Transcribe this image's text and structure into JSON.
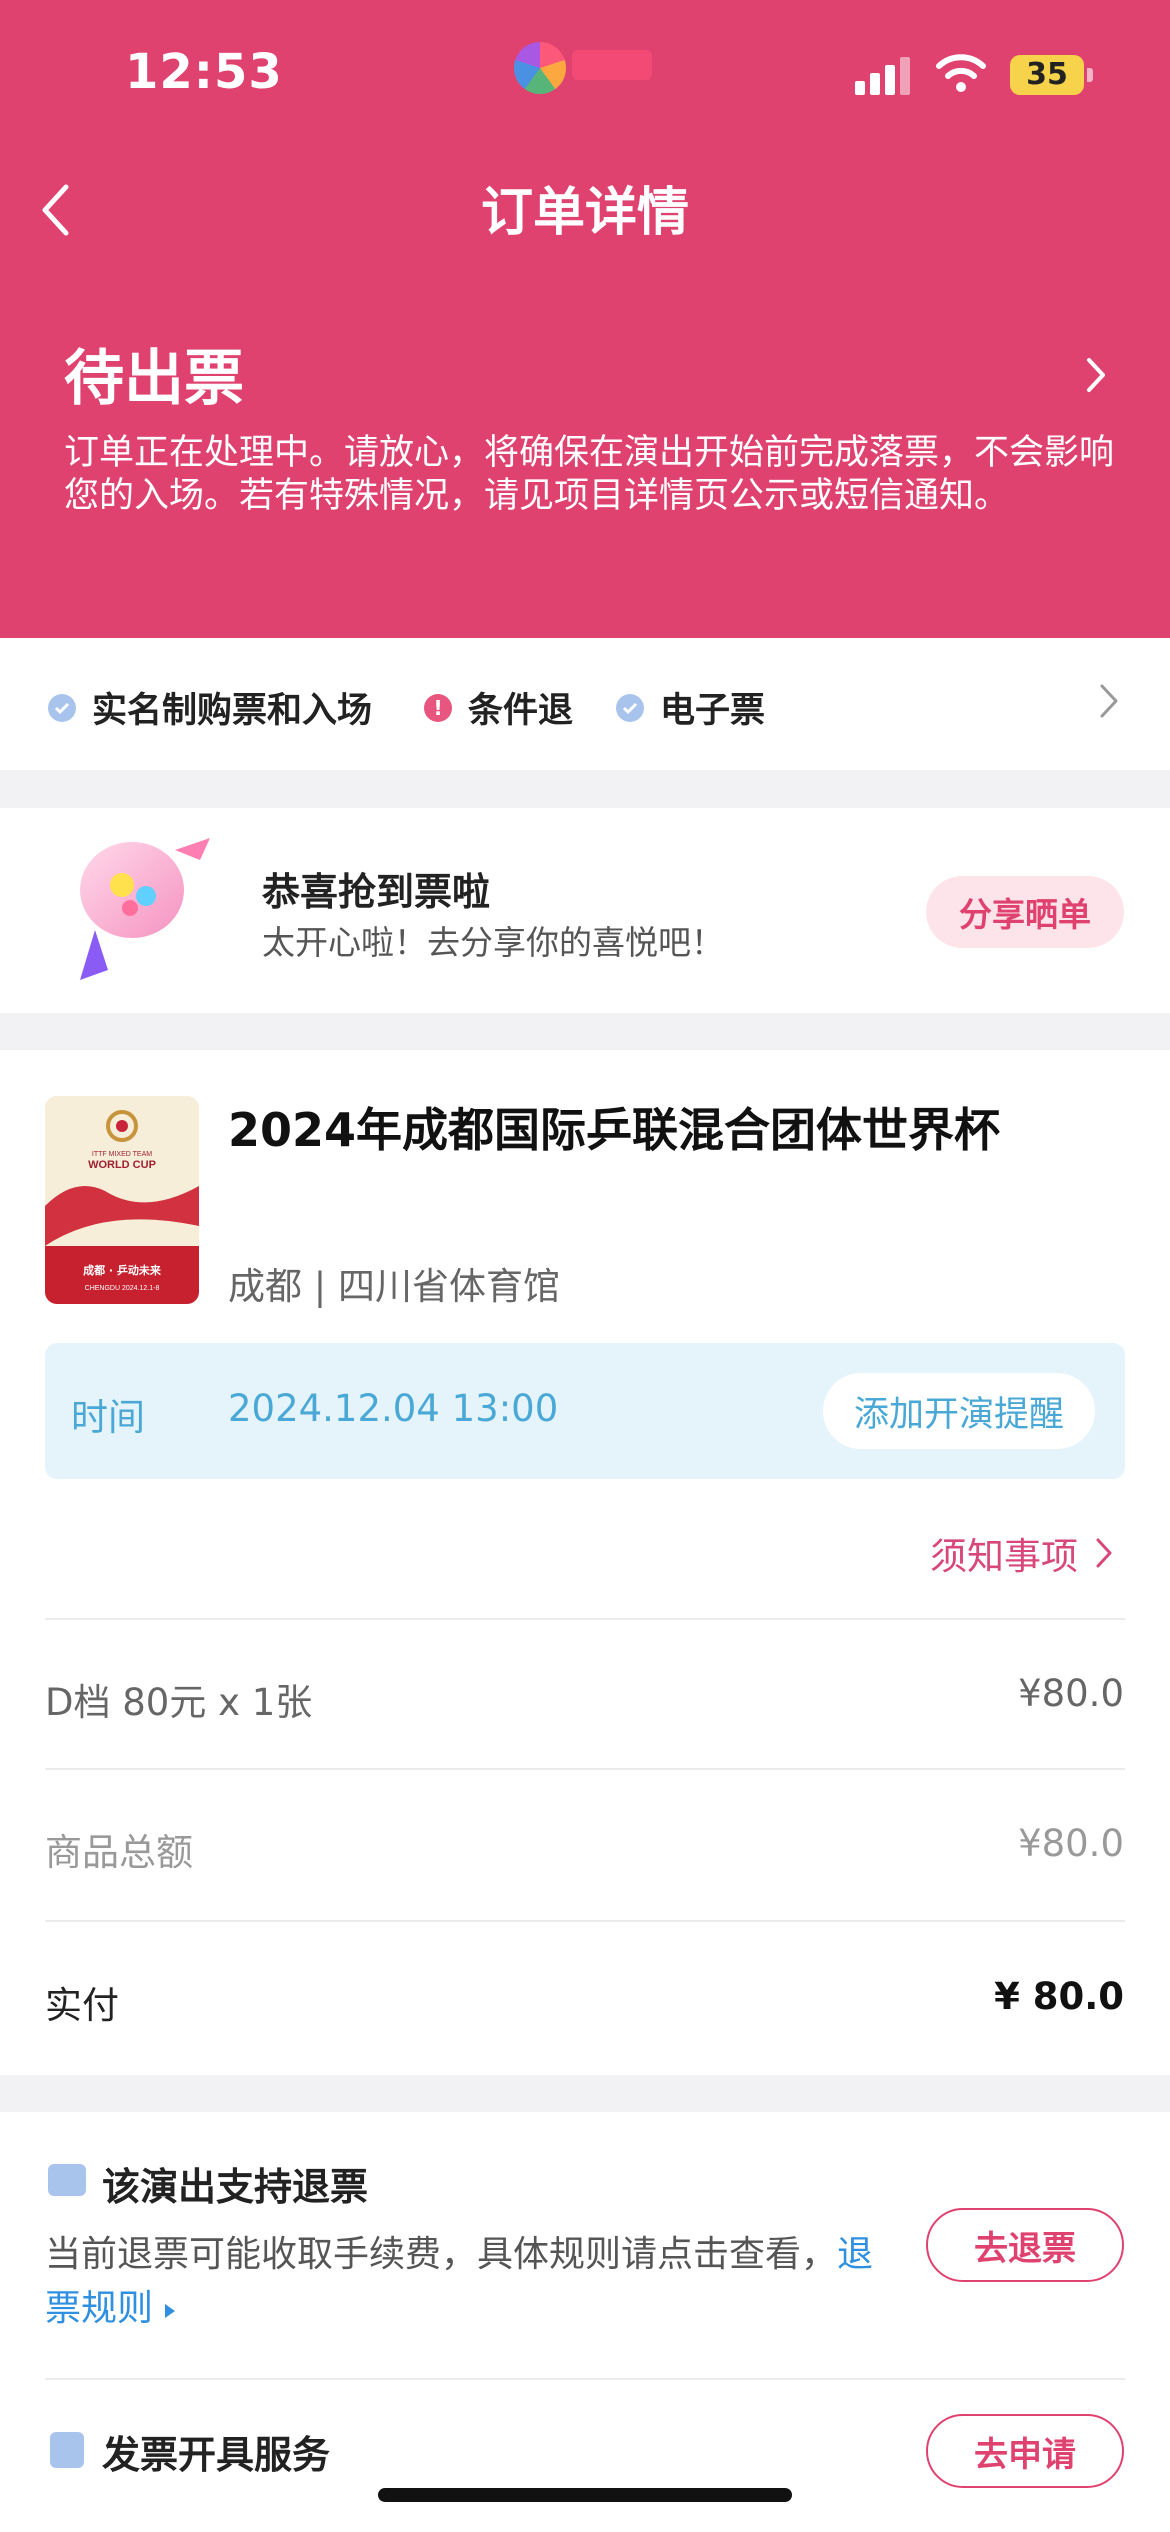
{
  "status_bar": {
    "time": "12:53",
    "battery": "35"
  },
  "nav": {
    "title": "订单详情"
  },
  "order_status": {
    "title": "待出票",
    "description": "订单正在处理中。请放心，将确保在演出开始前完成落票，不会影响您的入场。若有特殊情况，请见项目详情页公示或短信通知。"
  },
  "policies": [
    {
      "label": "实名制购票和入场",
      "icon": "check-circle-icon"
    },
    {
      "label": "条件退",
      "icon": "warning-circle-icon",
      "mark": "!"
    },
    {
      "label": "电子票",
      "icon": "check-circle-icon"
    }
  ],
  "share": {
    "title": "恭喜抢到票啦",
    "subtitle": "太开心啦！去分享你的喜悦吧！",
    "button": "分享晒单"
  },
  "event": {
    "title": "2024年成都国际乒联混合团体世界杯",
    "venue": "成都 | 四川省体育馆",
    "time_label": "时间",
    "time_value": "2024.12.04 13:00",
    "remind_button": "添加开演提醒",
    "notice_link": "须知事项"
  },
  "poster": {
    "line1": "ITTF MIXED TEAM",
    "line2": "WORLD CUP",
    "line3": "成都 · 乒动未来",
    "line4": "CHENGDU 2024.12.1-8"
  },
  "price": {
    "ticket_label": "D档 80元 x 1张",
    "ticket_value": "¥80.0",
    "subtotal_label": "商品总额",
    "subtotal_value": "¥80.0",
    "paid_label": "实付",
    "paid_value": "¥ 80.0"
  },
  "refund": {
    "title": "该演出支持退票",
    "desc": "当前退票可能收取手续费，具体规则请点击查看，",
    "link": "退票规则",
    "button": "去退票"
  },
  "invoice": {
    "title": "发票开具服务",
    "button": "去申请"
  },
  "colors": {
    "brand": "#e04270",
    "link_blue": "#2f8fe0",
    "time_blue": "#4aa8d6"
  }
}
